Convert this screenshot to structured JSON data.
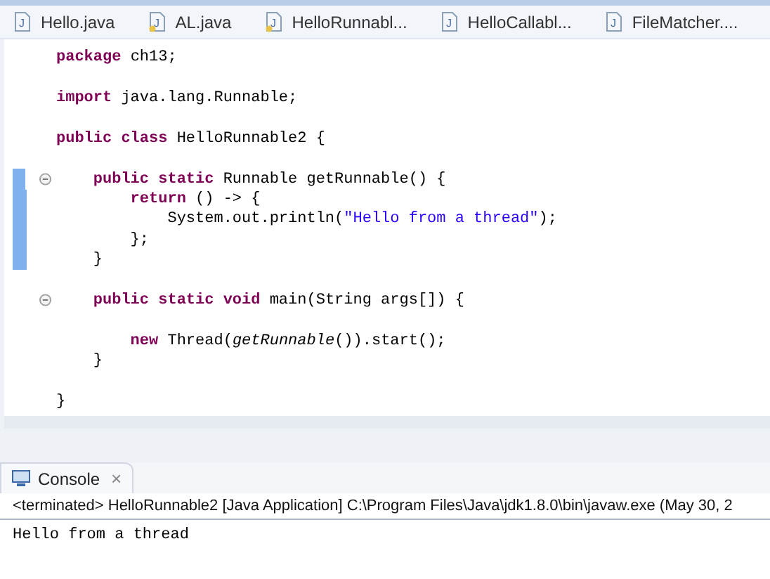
{
  "editor_tabs": [
    {
      "icon": "J",
      "label": "Hello.java",
      "warning": false
    },
    {
      "icon": "J",
      "label": "AL.java",
      "warning": true
    },
    {
      "icon": "J",
      "label": "HelloRunnabl...",
      "warning": true
    },
    {
      "icon": "J",
      "label": "HelloCallabl...",
      "warning": false
    },
    {
      "icon": "J",
      "label": "FileMatcher....",
      "warning": false
    }
  ],
  "code_lines": [
    {
      "fold": false,
      "changed": false,
      "tokens": [
        {
          "kind": "keyword",
          "text": "package"
        },
        {
          "kind": "plain",
          "text": " ch13;"
        }
      ]
    },
    {
      "fold": false,
      "changed": false
    },
    {
      "fold": false,
      "changed": false,
      "tokens": [
        {
          "kind": "keyword",
          "text": "import"
        },
        {
          "kind": "plain",
          "text": " java.lang.Runnable;"
        }
      ]
    },
    {
      "fold": false,
      "changed": false
    },
    {
      "fold": false,
      "changed": false,
      "tokens": [
        {
          "kind": "keyword",
          "text": "public class"
        },
        {
          "kind": "plain",
          "text": " HelloRunnable2 {"
        }
      ]
    },
    {
      "fold": false,
      "changed": false
    },
    {
      "fold": true,
      "changed": true,
      "tokens": [
        {
          "kind": "keyword",
          "text": "    public static"
        },
        {
          "kind": "plain",
          "text": " Runnable getRunnable() {"
        }
      ]
    },
    {
      "fold": false,
      "changed": true,
      "tokens": [
        {
          "kind": "keyword",
          "text": "        return"
        },
        {
          "kind": "plain",
          "text": " () -> {"
        }
      ]
    },
    {
      "fold": false,
      "changed": true,
      "tokens": [
        {
          "kind": "plain",
          "text": "            System.out.println("
        },
        {
          "kind": "string",
          "text": "\"Hello from a thread\""
        },
        {
          "kind": "plain",
          "text": ");"
        }
      ]
    },
    {
      "fold": false,
      "changed": true,
      "tokens": [
        {
          "kind": "plain",
          "text": "        };"
        }
      ]
    },
    {
      "fold": false,
      "changed": true,
      "tokens": [
        {
          "kind": "plain",
          "text": "    }"
        }
      ]
    },
    {
      "fold": false,
      "changed": false
    },
    {
      "fold": true,
      "changed": false,
      "tokens": [
        {
          "kind": "keyword",
          "text": "    public static void"
        },
        {
          "kind": "plain",
          "text": " main(String args[]) {"
        }
      ]
    },
    {
      "fold": false,
      "changed": false
    },
    {
      "fold": false,
      "changed": false,
      "tokens": [
        {
          "kind": "keyword",
          "text": "        new"
        },
        {
          "kind": "plain",
          "text": " Thread("
        },
        {
          "kind": "italic",
          "text": "getRunnable"
        },
        {
          "kind": "plain",
          "text": "()).start();"
        }
      ]
    },
    {
      "fold": false,
      "changed": false,
      "tokens": [
        {
          "kind": "plain",
          "text": "    }"
        }
      ]
    },
    {
      "fold": false,
      "changed": false
    },
    {
      "fold": false,
      "changed": false,
      "tokens": [
        {
          "kind": "plain",
          "text": "}"
        }
      ]
    }
  ],
  "console": {
    "tab_label": "Console",
    "close": "×",
    "header": "<terminated> HelloRunnable2 [Java Application] C:\\Program Files\\Java\\jdk1.8.0\\bin\\javaw.exe (May 30, 2",
    "output": "Hello from a thread"
  }
}
